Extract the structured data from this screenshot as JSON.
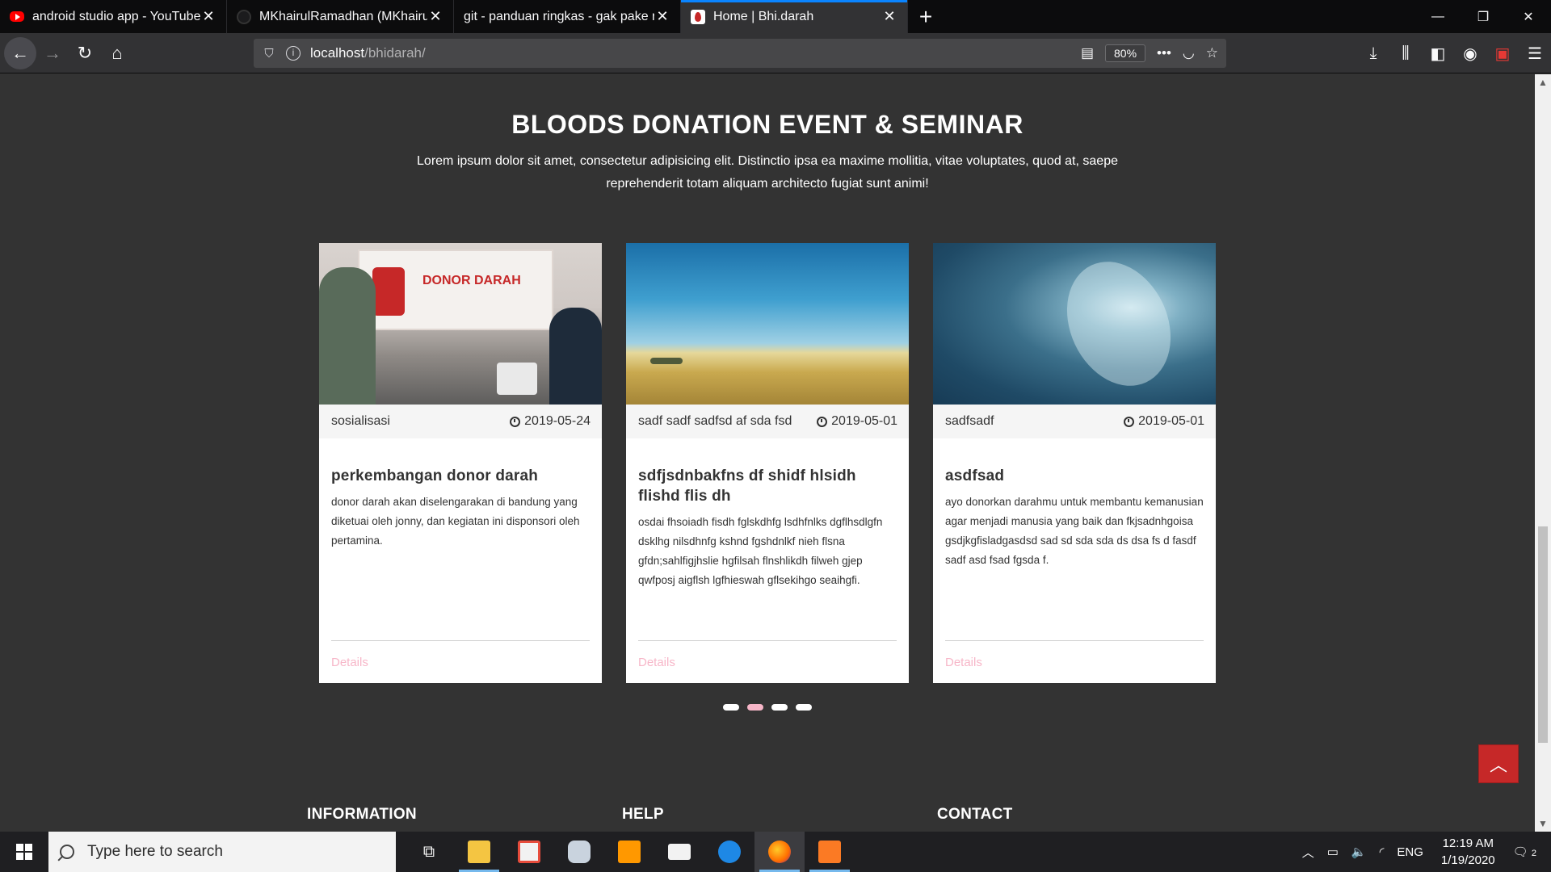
{
  "browser": {
    "tabs": [
      {
        "title": "android studio app - YouTube",
        "favicon": "youtube-icon",
        "active": false
      },
      {
        "title": "MKhairulRamadhan (MKhairulR",
        "favicon": "github-icon",
        "active": false
      },
      {
        "title": "git - panduan ringkas - gak pake ri",
        "favicon": "",
        "active": false
      },
      {
        "title": "Home | Bhi.darah",
        "favicon": "blood-drop-icon",
        "active": true
      }
    ],
    "url_host": "localhost",
    "url_path": "/bhidarah/",
    "zoom": "80%"
  },
  "section": {
    "title": "BLOODS DONATION EVENT & SEMINAR",
    "subtitle": "Lorem ipsum dolor sit amet, consectetur adipisicing elit. Distinctio ipsa ea maxime mollitia, vitae voluptates, quod at, saepe reprehenderit totam aliquam architecto fugiat sunt animi!"
  },
  "cards": [
    {
      "category": "sosialisasi",
      "date": "2019-05-24",
      "title": "perkembangan donor darah",
      "text": "donor darah akan diselengarakan di bandung yang diketuai oleh jonny, dan kegiatan ini disponsori oleh pertamina.",
      "link": "Details",
      "image_text": "DONOR DARAH"
    },
    {
      "category": "sadf sadf sadfsd af sda fsd",
      "date": "2019-05-01",
      "title": "sdfjsdnbakfns df shidf hlsidh flishd flis dh",
      "text": "osdai fhsoiadh fisdh fglskdhfg lsdhfnlks dgflhsdlgfn dsklhg nilsdhnfg kshnd fgshdnlkf nieh flsna gfdn;sahlfigjhslie hgfilsah flnshlikdh filweh gjep qwfposj aigflsh lgfhieswah gflsekihgo seaihgfi.",
      "link": "Details"
    },
    {
      "category": "sadfsadf",
      "date": "2019-05-01",
      "title": "asdfsad",
      "text": "ayo donorkan darahmu untuk membantu kemanusian agar menjadi manusia yang baik dan fkjsadnhgoisa gsdjkgfisladgasdsd sad sd sda sda ds dsa fs d fasdf sadf asd fsad fgsda f.",
      "link": "Details"
    }
  ],
  "carousel": {
    "page_count": 4,
    "active_index": 1
  },
  "footer": {
    "headings": [
      "INFORMATION",
      "HELP",
      "CONTACT"
    ]
  },
  "taskbar": {
    "search_placeholder": "Type here to search",
    "language": "ENG",
    "time": "12:19 AM",
    "date": "1/19/2020",
    "notification_count": "2"
  },
  "colors": {
    "accent_pink": "#f7b6c8",
    "to_top_red": "#c62828",
    "page_bg": "#333333"
  }
}
